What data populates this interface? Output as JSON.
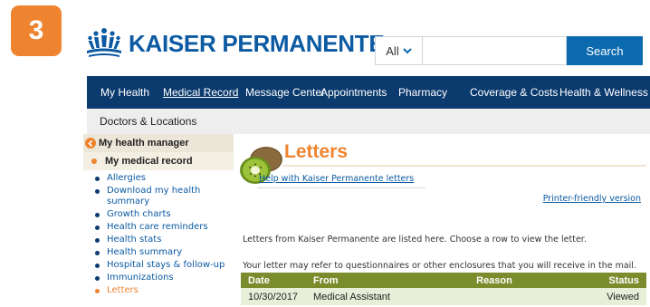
{
  "step_badge": "3",
  "brand": {
    "name": "KAISER PERMANENTE",
    "registered_mark": "®",
    "logo_icon": "kp-figures-icon",
    "colors": {
      "blue": "#0b5aa2",
      "navy": "#0b3a6e",
      "orange": "#ee8430",
      "olive": "#7b8c2c"
    }
  },
  "search": {
    "scope_label": "All",
    "query": "",
    "button_label": "Search"
  },
  "top_nav": {
    "items": [
      {
        "label": "My Health",
        "active": false
      },
      {
        "label": "Medical Record",
        "active": true
      },
      {
        "label": "Message Center",
        "active": false
      },
      {
        "label": "Appointments",
        "active": false
      },
      {
        "label": "Pharmacy",
        "active": false
      },
      {
        "label": "Coverage & Costs",
        "active": false
      },
      {
        "label": "Health & Wellness",
        "active": false
      }
    ]
  },
  "sub_nav": {
    "items": [
      {
        "label": "Doctors & Locations"
      }
    ]
  },
  "sidebar": {
    "parent": "My health manager",
    "section": "My medical record",
    "items": [
      {
        "label": "Allergies"
      },
      {
        "label": "Download my health summary"
      },
      {
        "label": "Growth charts"
      },
      {
        "label": "Health care reminders"
      },
      {
        "label": "Health stats"
      },
      {
        "label": "Health summary"
      },
      {
        "label": "Hospital stays & follow-up"
      },
      {
        "label": "Immunizations"
      },
      {
        "label": "Letters",
        "current": true
      }
    ]
  },
  "main": {
    "title": "Letters",
    "help_link": "Help with Kaiser Permanente letters",
    "printer_link": "Printer-friendly version",
    "intro": "Letters from Kaiser Permanente are listed here. Choose a row to view the letter.",
    "note": "Your letter may refer to questionnaires or other enclosures that you will receive in the mail.",
    "table": {
      "columns": [
        "Date",
        "From",
        "Reason",
        "Status"
      ],
      "rows": [
        {
          "date": "10/30/2017",
          "from": "Medical Assistant",
          "reason": "",
          "status": "Viewed"
        }
      ]
    }
  }
}
